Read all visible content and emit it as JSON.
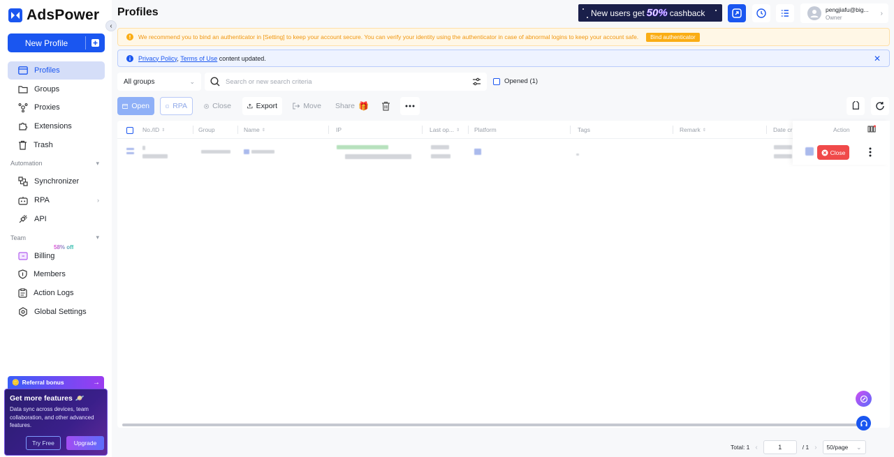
{
  "app": {
    "name": "AdsPower",
    "brand_color": "#1a56f0"
  },
  "sidebar": {
    "new_profile_label": "New Profile",
    "main_items": [
      {
        "label": "Profiles",
        "icon": "profiles-icon",
        "active": true
      },
      {
        "label": "Groups",
        "icon": "folder-icon"
      },
      {
        "label": "Proxies",
        "icon": "proxy-icon"
      },
      {
        "label": "Extensions",
        "icon": "puzzle-icon"
      },
      {
        "label": "Trash",
        "icon": "trash-icon"
      }
    ],
    "automation_label": "Automation",
    "automation_items": [
      {
        "label": "Synchronizer",
        "icon": "sync-icon"
      },
      {
        "label": "RPA",
        "icon": "robot-icon"
      },
      {
        "label": "API",
        "icon": "plug-icon"
      }
    ],
    "team_label": "Team",
    "team_items": [
      {
        "label": "Billing",
        "icon": "billing-icon",
        "badge": "58% off"
      },
      {
        "label": "Members",
        "icon": "shield-icon"
      },
      {
        "label": "Action Logs",
        "icon": "clipboard-icon"
      },
      {
        "label": "Global Settings",
        "icon": "settings-icon"
      }
    ],
    "promo": {
      "referral_label": "Referral bonus",
      "title": "Get more features",
      "description": "Data sync across devices, team collaboration, and other advanced features.",
      "try_label": "Try Free",
      "upgrade_label": "Upgrade"
    }
  },
  "header": {
    "title": "Profiles",
    "banner_prefix": "New users get",
    "banner_pct": "50%",
    "banner_suffix": "cashback",
    "user_name": "pengjiafu@big...",
    "user_role": "Owner"
  },
  "alerts": {
    "warning_text": "We recommend you to bind an authenticator in [Setting] to keep your account secure. You can verify your identity using the authenticator in case of abnormal logins to keep your account safe.",
    "bind_label": "Bind authenticator",
    "privacy_link": "Privacy Policy",
    "sep": ",",
    "terms_link": "Terms of Use",
    "info_suffix": "content updated."
  },
  "filters": {
    "group_select": "All groups",
    "search_placeholder": "Search or new search criteria",
    "opened_label": "Opened (1)"
  },
  "toolbar": {
    "open": "Open",
    "rpa": "RPA",
    "close": "Close",
    "export": "Export",
    "move": "Move",
    "share": "Share"
  },
  "table": {
    "columns": [
      "No./ID",
      "Group",
      "Name",
      "IP",
      "Last op...",
      "Platform",
      "Tags",
      "Remark",
      "Date cr",
      "Action"
    ],
    "row_close_label": "Close"
  },
  "pagination": {
    "total": "Total: 1",
    "page": "1",
    "of": "/ 1",
    "page_size": "50/page"
  }
}
